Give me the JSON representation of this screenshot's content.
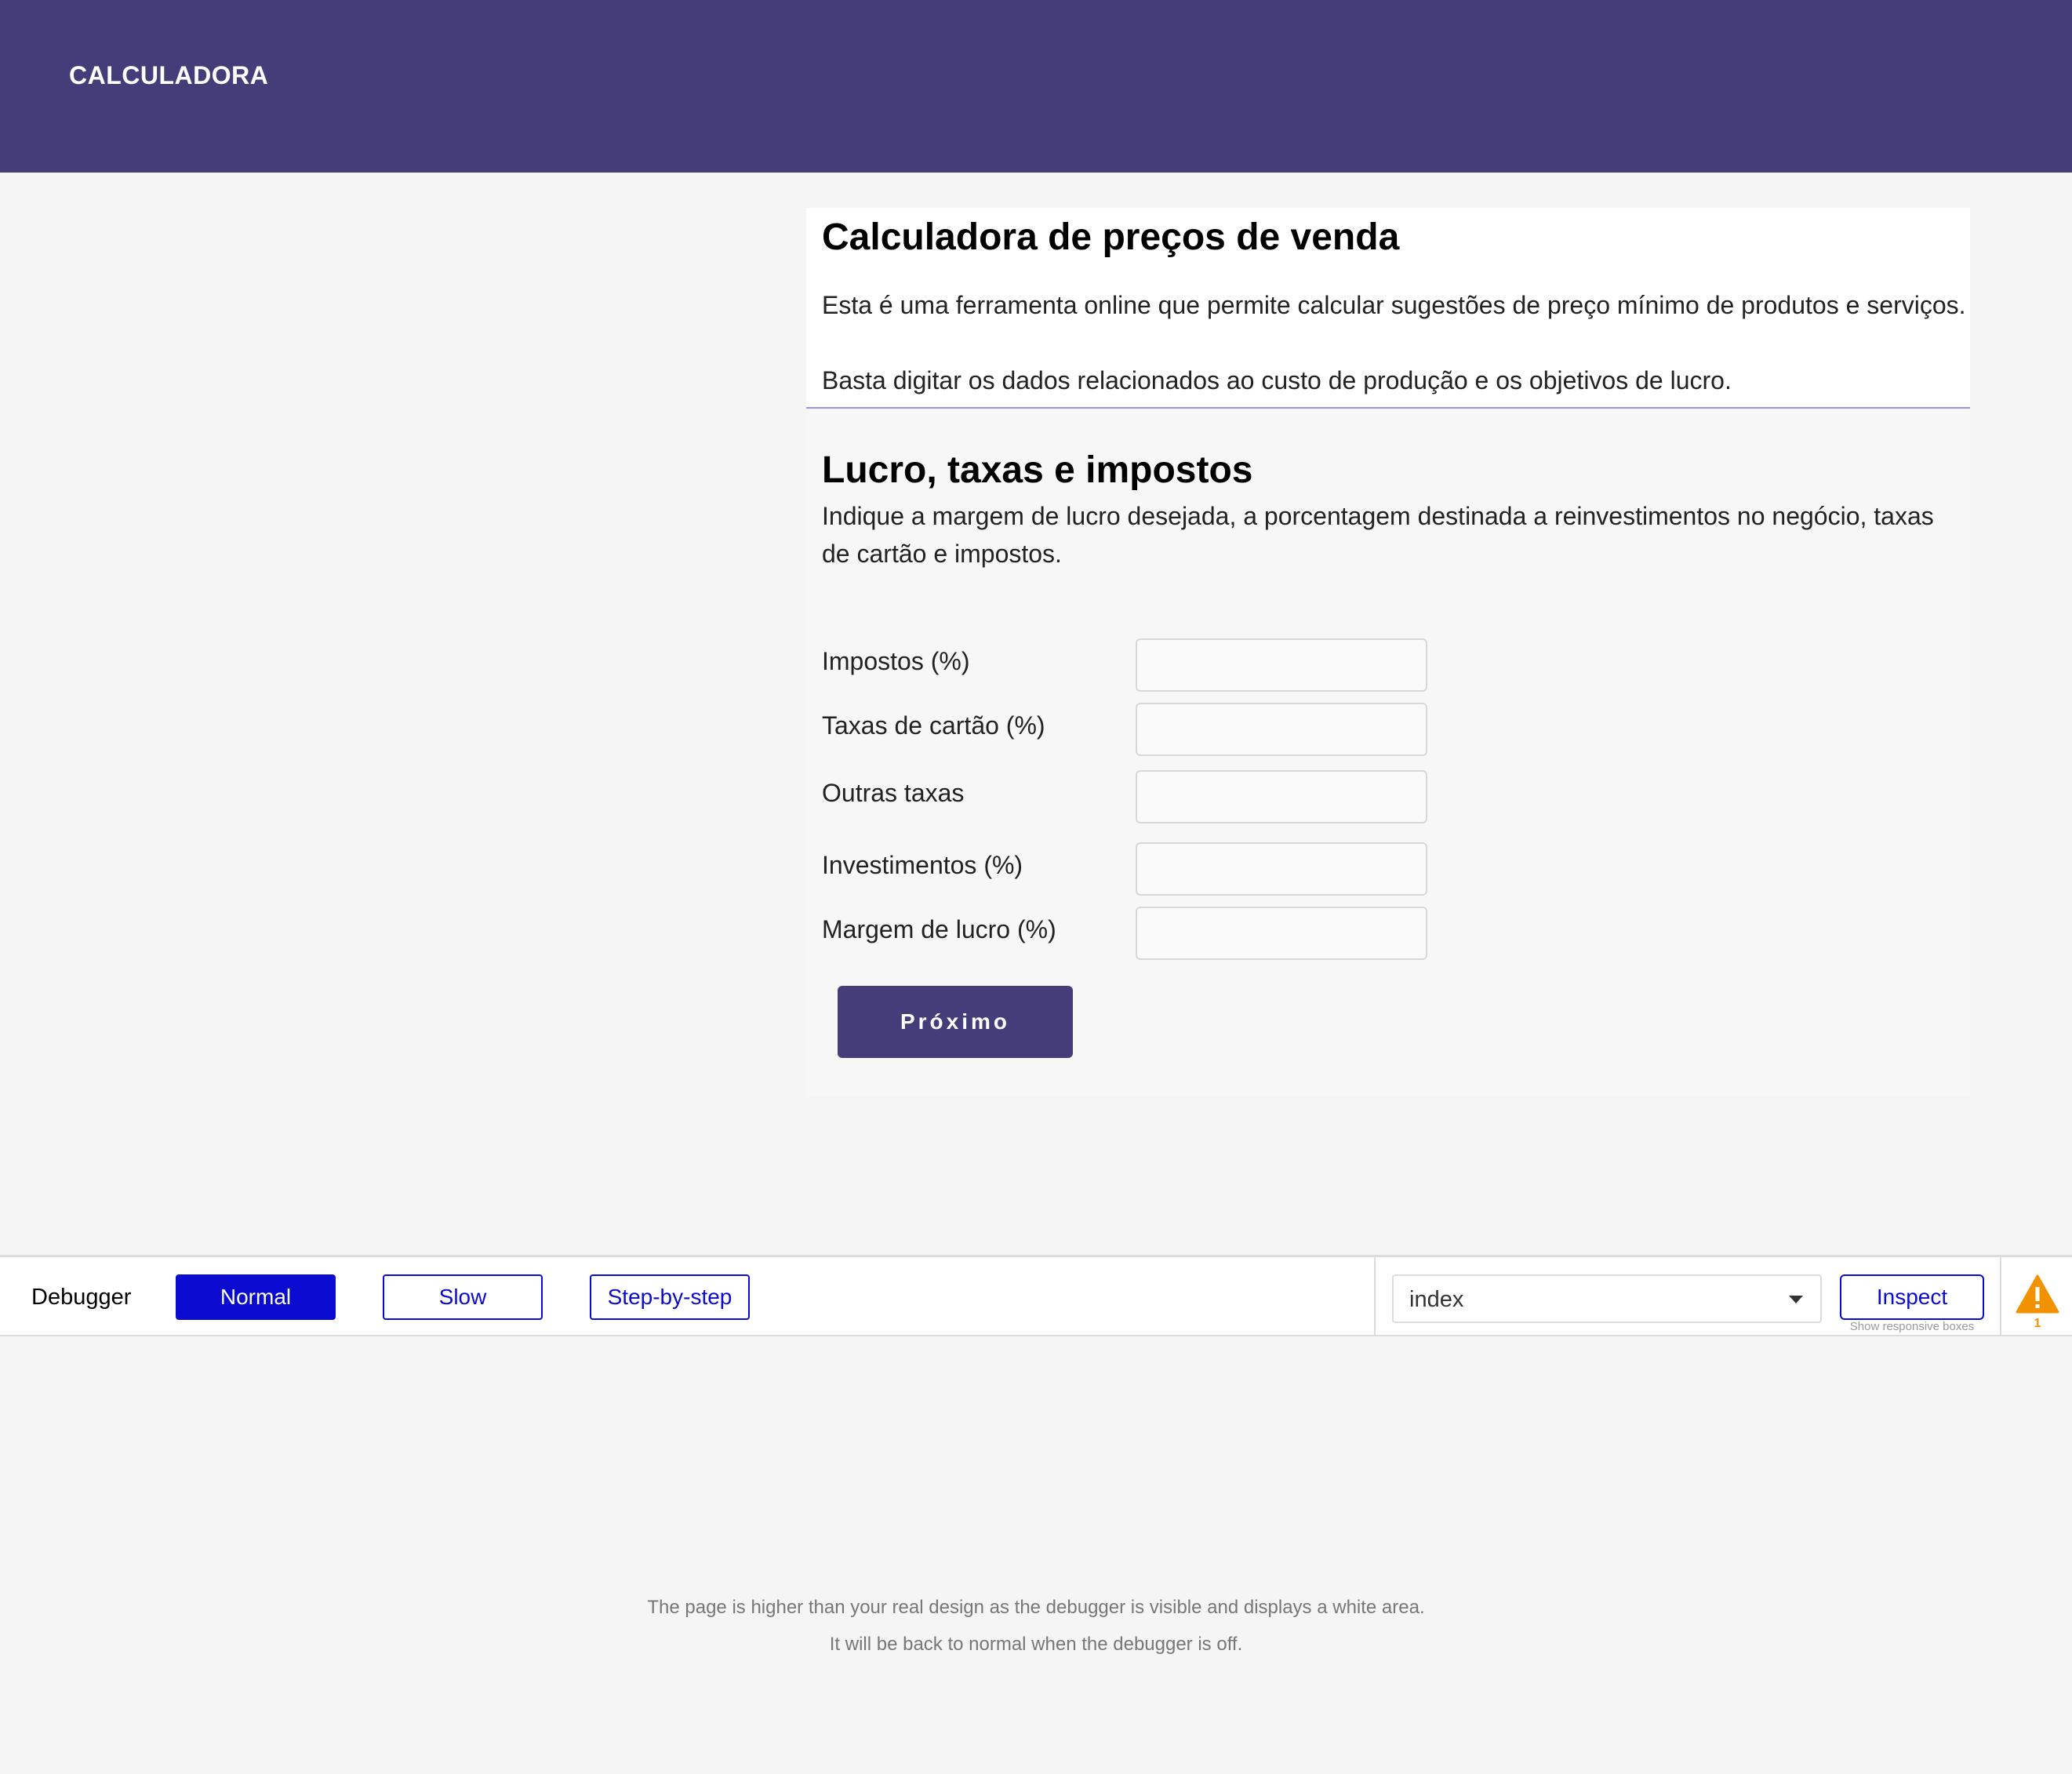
{
  "header": {
    "brand": "CALCULADORA"
  },
  "intro": {
    "title": "Calculadora de preços de venda",
    "paragraph1": "Esta é uma ferramenta online que permite calcular sugestões de preço mínimo de produtos e serviços.",
    "paragraph2": "Basta digitar os dados relacionados ao custo de produção e os objetivos de lucro."
  },
  "section": {
    "title": "Lucro, taxas e impostos",
    "description": "Indique a margem de lucro desejada, a porcentagem destinada a reinvestimentos no negócio, taxas de cartão e impostos."
  },
  "fields": [
    {
      "label": "Impostos (%)",
      "value": ""
    },
    {
      "label": "Taxas de cartão (%)",
      "value": ""
    },
    {
      "label": "Outras taxas",
      "value": ""
    },
    {
      "label": "Investimentos (%)",
      "value": ""
    },
    {
      "label": "Margem de lucro (%)",
      "value": ""
    }
  ],
  "next_button": "Próximo",
  "debugger": {
    "label": "Debugger",
    "modes": [
      "Normal",
      "Slow",
      "Step-by-step"
    ],
    "active_mode": "Normal",
    "page_select": "index",
    "inspect_label": "Inspect",
    "inspect_sub": "Show responsive boxes",
    "warning_count": "1"
  },
  "footnote": {
    "line1": "The page is higher than your real design as the debugger is visible and displays a white area.",
    "line2": "It will be back to normal when the debugger is off."
  },
  "colors": {
    "header_bg": "#443d79",
    "accent_blue": "#0a0ad0",
    "warning": "#f39200"
  }
}
